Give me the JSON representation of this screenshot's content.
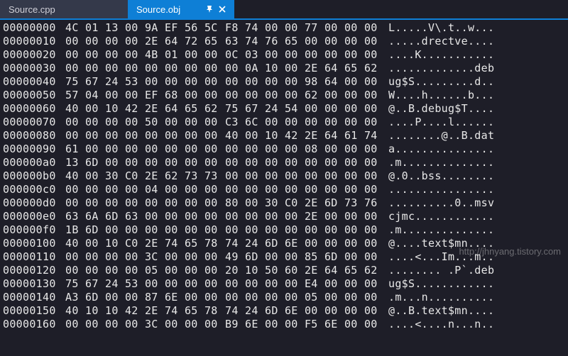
{
  "tabs": {
    "inactive": {
      "label": "Source.cpp"
    },
    "active": {
      "label": "Source.obj"
    }
  },
  "watermark": "http://jhnyang.tistory.com",
  "hex_rows": [
    {
      "offset": "00000000",
      "b1": "4C 01 13 00 9A EF 56 5C",
      "b2": "F8 74 00 00 77 00 00 00",
      "ascii": "L.....V\\.t..w..."
    },
    {
      "offset": "00000010",
      "b1": "00 00 00 00 2E 64 72 65",
      "b2": "63 74 76 65 00 00 00 00",
      "ascii": ".....drectve...."
    },
    {
      "offset": "00000020",
      "b1": "00 00 00 00 4B 01 00 00",
      "b2": "0C 03 00 00 00 00 00 00",
      "ascii": "....K..........."
    },
    {
      "offset": "00000030",
      "b1": "00 00 00 00 00 00 00 00",
      "b2": "00 0A 10 00 2E 64 65 62",
      "ascii": ".............deb"
    },
    {
      "offset": "00000040",
      "b1": "75 67 24 53 00 00 00 00",
      "b2": "00 00 00 00 98 64 00 00",
      "ascii": "ug$S.........d.."
    },
    {
      "offset": "00000050",
      "b1": "57 04 00 00 EF 68 00 00",
      "b2": "00 00 00 00 62 00 00 00",
      "ascii": "W....h......b..."
    },
    {
      "offset": "00000060",
      "b1": "40 00 10 42 2E 64 65 62",
      "b2": "75 67 24 54 00 00 00 00",
      "ascii": "@..B.debug$T...."
    },
    {
      "offset": "00000070",
      "b1": "00 00 00 00 50 00 00 00",
      "b2": "C3 6C 00 00 00 00 00 00",
      "ascii": "....P....l......"
    },
    {
      "offset": "00000080",
      "b1": "00 00 00 00 00 00 00 00",
      "b2": "40 00 10 42 2E 64 61 74",
      "ascii": "........@..B.dat"
    },
    {
      "offset": "00000090",
      "b1": "61 00 00 00 00 00 00 00",
      "b2": "00 00 00 00 08 00 00 00",
      "ascii": "a..............."
    },
    {
      "offset": "000000a0",
      "b1": "13 6D 00 00 00 00 00 00",
      "b2": "00 00 00 00 00 00 00 00",
      "ascii": ".m.............."
    },
    {
      "offset": "000000b0",
      "b1": "40 00 30 C0 2E 62 73 73",
      "b2": "00 00 00 00 00 00 00 00",
      "ascii": "@.0..bss........"
    },
    {
      "offset": "000000c0",
      "b1": "00 00 00 00 04 00 00 00",
      "b2": "00 00 00 00 00 00 00 00",
      "ascii": "................"
    },
    {
      "offset": "000000d0",
      "b1": "00 00 00 00 00 00 00 00",
      "b2": "80 00 30 C0 2E 6D 73 76",
      "ascii": "..........0..msv"
    },
    {
      "offset": "000000e0",
      "b1": "63 6A 6D 63 00 00 00 00",
      "b2": "00 00 00 00 2E 00 00 00",
      "ascii": "cjmc............"
    },
    {
      "offset": "000000f0",
      "b1": "1B 6D 00 00 00 00 00 00",
      "b2": "00 00 00 00 00 00 00 00",
      "ascii": ".m.............."
    },
    {
      "offset": "00000100",
      "b1": "40 00 10 C0 2E 74 65 78",
      "b2": "74 24 6D 6E 00 00 00 00",
      "ascii": "@....text$mn...."
    },
    {
      "offset": "00000110",
      "b1": "00 00 00 00 3C 00 00 00",
      "b2": "49 6D 00 00 85 6D 00 00",
      "ascii": "....<...Im...m.."
    },
    {
      "offset": "00000120",
      "b1": "00 00 00 00 05 00 00 00",
      "b2": "20 10 50 60 2E 64 65 62",
      "ascii": "........ .P`.deb"
    },
    {
      "offset": "00000130",
      "b1": "75 67 24 53 00 00 00 00",
      "b2": "00 00 00 00 E4 00 00 00",
      "ascii": "ug$S............"
    },
    {
      "offset": "00000140",
      "b1": "A3 6D 00 00 87 6E 00 00",
      "b2": "00 00 00 00 05 00 00 00",
      "ascii": ".m...n.........."
    },
    {
      "offset": "00000150",
      "b1": "40 10 10 42 2E 74 65 78",
      "b2": "74 24 6D 6E 00 00 00 00",
      "ascii": "@..B.text$mn...."
    },
    {
      "offset": "00000160",
      "b1": "00 00 00 00 3C 00 00 00",
      "b2": "B9 6E 00 00 F5 6E 00 00",
      "ascii": "....<....n...n.."
    }
  ]
}
